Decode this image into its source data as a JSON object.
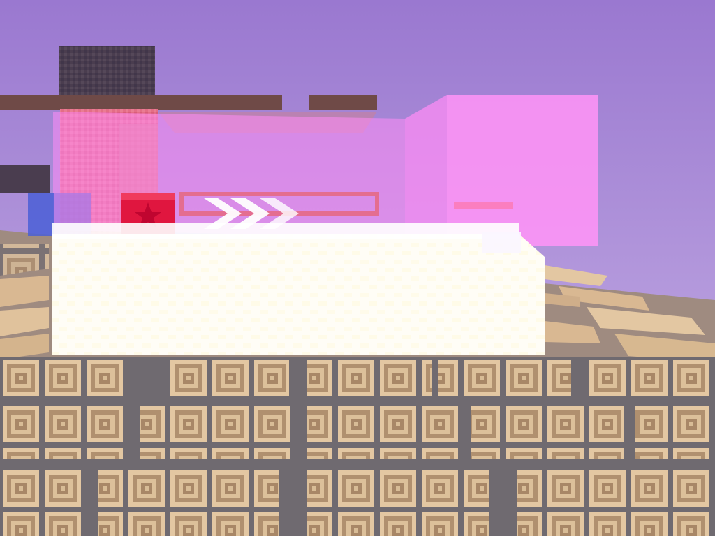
{
  "scene": {
    "type": "3d-voxel-game-view",
    "sky_color_top": "#9a78d0",
    "sky_color_bottom": "#c9b4e6",
    "floor_tile_light": "#d9b892",
    "floor_tile_dark": "#9c7f63",
    "floor_grout": "#6f6a70",
    "objects": [
      {
        "name": "dark-stone-block",
        "color": "#4a3d4f"
      },
      {
        "name": "brown-beam",
        "color": "#6f4a47"
      },
      {
        "name": "pink-pillar",
        "color": "#e46d86"
      },
      {
        "name": "translucent-pink-glass",
        "color": "#ff8cf5"
      },
      {
        "name": "blue-glass-cube",
        "color": "#4a5fd6"
      },
      {
        "name": "purple-glass-cube",
        "color": "#a778e6"
      },
      {
        "name": "red-star-block",
        "color": "#e0163f"
      },
      {
        "name": "white-glowing-platform",
        "color": "#fffdf6"
      },
      {
        "name": "double-chevron-sign",
        "color": "#ffffff"
      }
    ]
  }
}
